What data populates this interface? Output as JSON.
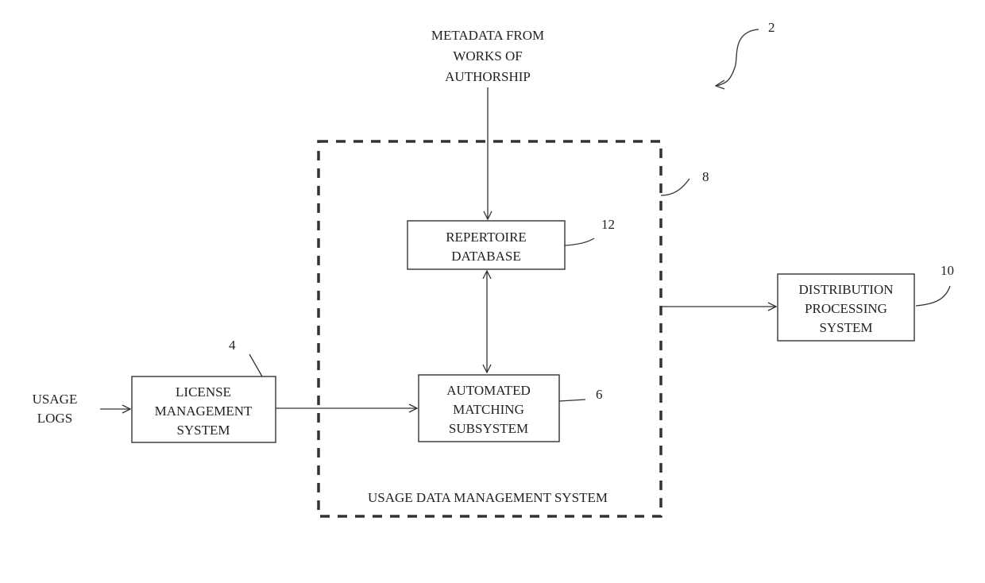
{
  "figure_ref": "2",
  "inputs": {
    "metadata": [
      "METADATA FROM",
      "WORKS OF",
      "AUTHORSHIP"
    ],
    "usage_logs": [
      "USAGE",
      "LOGS"
    ]
  },
  "container": {
    "ref": "8",
    "label": "USAGE DATA MANAGEMENT SYSTEM"
  },
  "boxes": {
    "license": {
      "ref": "4",
      "lines": [
        "LICENSE",
        "MANAGEMENT",
        "SYSTEM"
      ]
    },
    "repertoire": {
      "ref": "12",
      "lines": [
        "REPERTOIRE",
        "DATABASE"
      ]
    },
    "matching": {
      "ref": "6",
      "lines": [
        "AUTOMATED",
        "MATCHING",
        "SUBSYSTEM"
      ]
    },
    "distribution": {
      "ref": "10",
      "lines": [
        "DISTRIBUTION",
        "PROCESSING",
        "SYSTEM"
      ]
    }
  },
  "connections": [
    {
      "from": "metadata",
      "to": "repertoire",
      "direction": "one-way"
    },
    {
      "from": "repertoire",
      "to": "matching",
      "direction": "two-way"
    },
    {
      "from": "usage_logs",
      "to": "license",
      "direction": "one-way"
    },
    {
      "from": "license",
      "to": "matching",
      "direction": "one-way"
    },
    {
      "from": "container",
      "to": "distribution",
      "direction": "one-way"
    }
  ]
}
